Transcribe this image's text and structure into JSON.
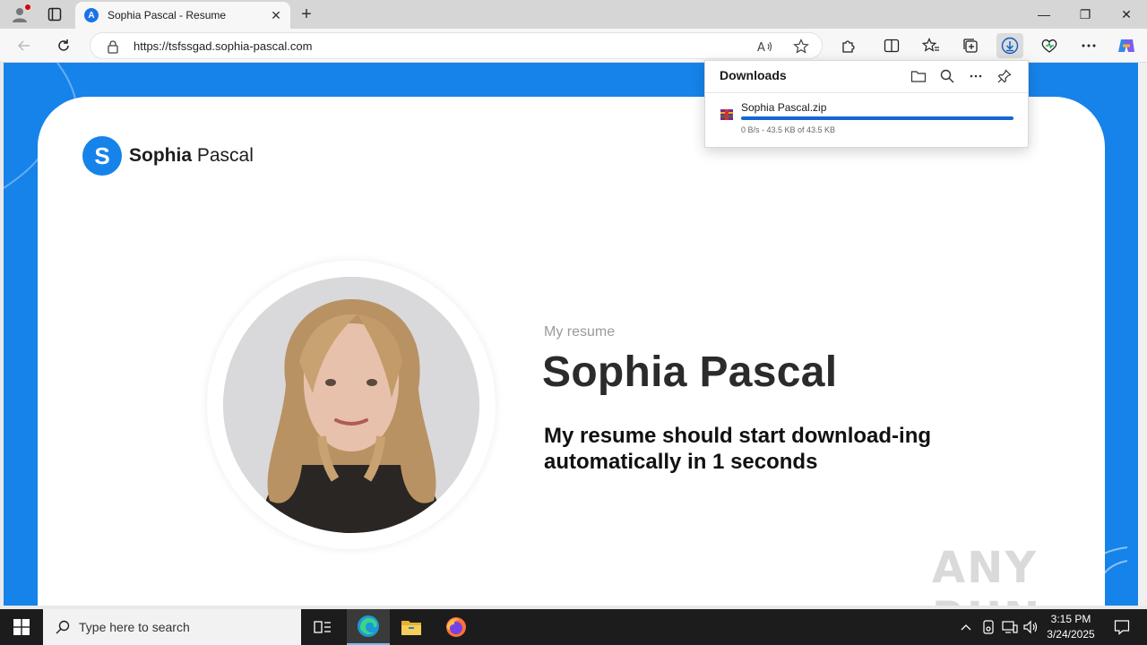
{
  "browser": {
    "tab_title": "Sophia Pascal - Resume",
    "tab_favicon_letter": "A",
    "url": "https://tsfssgad.sophia-pascal.com",
    "minimize_glyph": "—",
    "maximize_glyph": "❐",
    "close_glyph": "✕",
    "new_tab_glyph": "+",
    "tab_close_glyph": "✕"
  },
  "page": {
    "brand_logo_letter": "S",
    "brand_first": "Sophia",
    "brand_last": " Pascal",
    "eyebrow": "My resume",
    "name": "Sophia Pascal",
    "message": "My resume should start download-ing automatically in 1 seconds",
    "accent_color": "#1683ea"
  },
  "downloads": {
    "title": "Downloads",
    "file_name": "Sophia Pascal.zip",
    "status": "0 B/s - 43.5 KB of 43.5 KB",
    "progress": 1.0
  },
  "watermark": "ANY RUN",
  "taskbar": {
    "search_placeholder": "Type here to search",
    "time": "3:15 PM",
    "date": "3/24/2025"
  },
  "icons": [
    "profile-icon",
    "tab-actions-icon",
    "back-icon",
    "refresh-icon",
    "lock-icon",
    "read-aloud-icon",
    "favorite-star-icon",
    "extensions-icon",
    "split-screen-icon",
    "favorites-icon",
    "collections-icon",
    "downloads-icon",
    "browser-essentials-icon",
    "more-icon",
    "copilot-icon",
    "folder-icon",
    "search-icon",
    "pin-icon",
    "zip-file-icon",
    "windows-start-icon",
    "task-view-icon",
    "edge-icon",
    "file-explorer-icon",
    "firefox-icon",
    "chevron-up-icon",
    "network-icon",
    "volume-icon",
    "notifications-icon"
  ]
}
